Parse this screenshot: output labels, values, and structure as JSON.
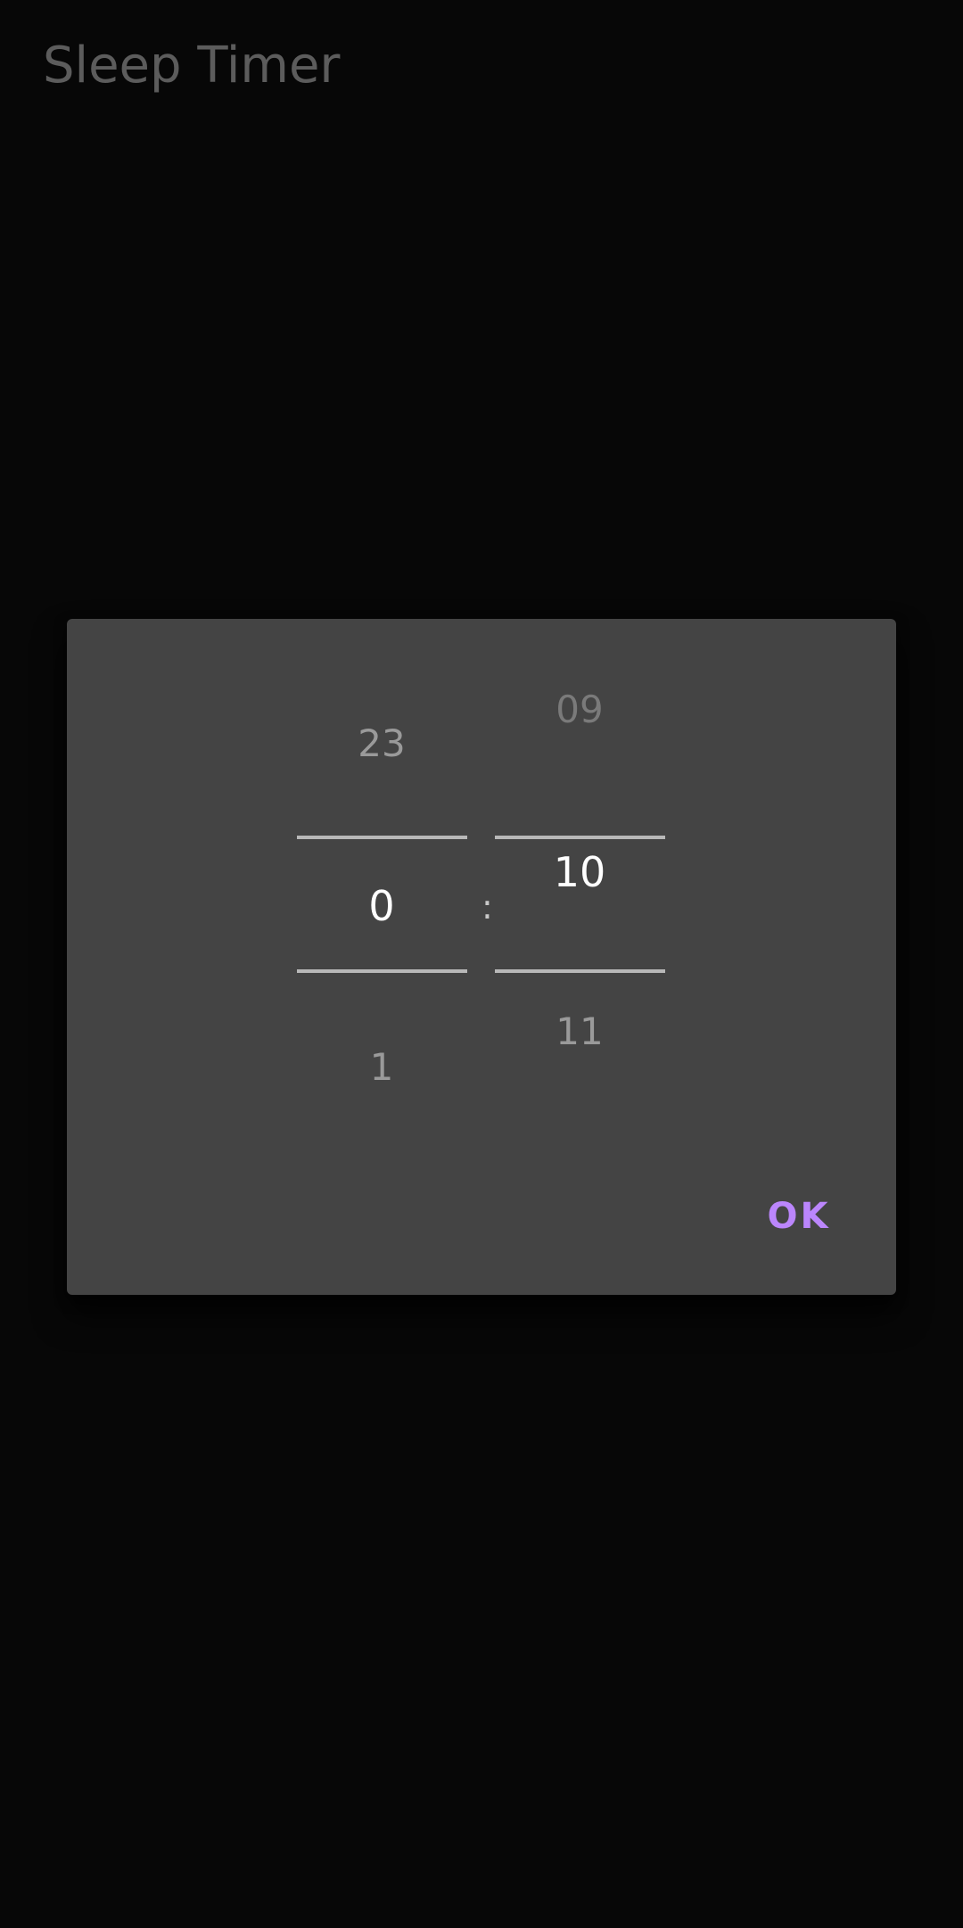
{
  "app": {
    "title": "Sleep Timer"
  },
  "timer_picker": {
    "hours": {
      "previous": "23",
      "current": "0",
      "next": "1"
    },
    "separator": ":",
    "minutes": {
      "previous": "09",
      "current": "10",
      "next": "11"
    }
  },
  "dialog": {
    "ok_label": "OK"
  },
  "colors": {
    "background": "#070707",
    "dialog_background": "#444444",
    "accent": "#bb86fc",
    "selected_text": "#ffffff",
    "dim_text": "#9a9a9a"
  }
}
